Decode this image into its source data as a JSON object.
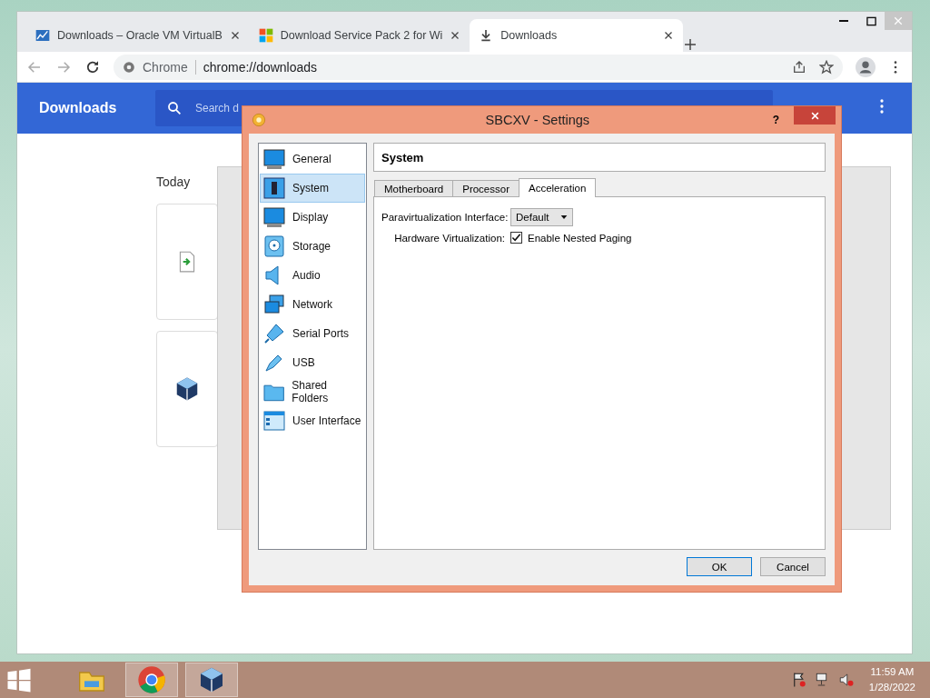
{
  "browser": {
    "tabs": [
      {
        "title": "Downloads – Oracle VM VirtualB",
        "selected": false
      },
      {
        "title": "Download Service Pack 2 for Wi",
        "selected": false
      },
      {
        "title": "Downloads",
        "selected": true
      }
    ],
    "address": {
      "site_label": "Chrome",
      "url": "chrome://downloads"
    },
    "header": {
      "title": "Downloads",
      "search_placeholder": "Search d"
    },
    "section": "Today"
  },
  "dialog": {
    "title": "SBCXV - Settings",
    "help": "?",
    "page_title": "System",
    "categories": [
      {
        "label": "General",
        "selected": false
      },
      {
        "label": "System",
        "selected": true
      },
      {
        "label": "Display",
        "selected": false
      },
      {
        "label": "Storage",
        "selected": false
      },
      {
        "label": "Audio",
        "selected": false
      },
      {
        "label": "Network",
        "selected": false
      },
      {
        "label": "Serial Ports",
        "selected": false
      },
      {
        "label": "USB",
        "selected": false
      },
      {
        "label": "Shared Folders",
        "selected": false
      },
      {
        "label": "User Interface",
        "selected": false
      }
    ],
    "tabs": [
      {
        "label": "Motherboard",
        "selected": false
      },
      {
        "label": "Processor",
        "selected": false
      },
      {
        "label": "Acceleration",
        "selected": true
      }
    ],
    "fields": [
      {
        "kind": "select",
        "label": "Paravirtualization Interface:",
        "value": "Default"
      },
      {
        "kind": "checkbox",
        "label": "Hardware Virtualization:",
        "option": "Enable Nested Paging",
        "checked": true
      }
    ],
    "buttons": [
      {
        "label": "OK",
        "default": true
      },
      {
        "label": "Cancel",
        "default": false
      }
    ]
  },
  "taskbar": {
    "apps": [
      {
        "selected": false
      },
      {
        "selected": true
      },
      {
        "selected": true
      }
    ],
    "time": "11:59 AM",
    "date": "1/28/2022"
  }
}
